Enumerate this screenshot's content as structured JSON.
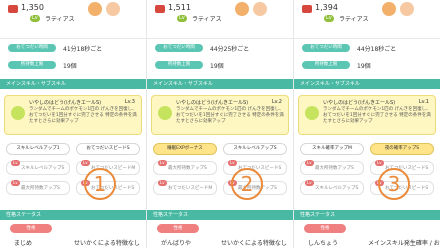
{
  "panels": [
    {
      "hp": "1,350",
      "badge": "Lv",
      "pokemon_name": "ラティアス",
      "stats": [
        {
          "label": "おてつだい時間",
          "value": "41分18秒ごと"
        },
        {
          "label": "所持数上限",
          "value": "19個"
        }
      ],
      "section_title": "メインスキル・サブスキル",
      "skill": {
        "name": "いやしのはどう(げんきエールS)",
        "level": "Lv.3",
        "description": "ランダムでチームのポケモン1匹の げんきを回復し、おてつだいを1回分すぐに完了させる 特定の条件を満たすとさらに効果アップ"
      },
      "buttons": [
        {
          "label": "スキルレベルアップ1",
          "highlight": false
        },
        {
          "label": "おてつだいスピードS",
          "highlight": false
        }
      ],
      "subskills": [
        [
          "スキルレベルアップS",
          "おてつだいスピードM"
        ],
        [
          "最大所持数アップS",
          "おてつだいスピードS"
        ]
      ],
      "number": "1",
      "section2": "性格ステータス",
      "sub_label": "性格",
      "nature": "まじめ",
      "effect": "せいかくによる特徴なし",
      "colors": {
        "pk_a": "#f2b06a",
        "pk_b": "#f7c9a2"
      }
    },
    {
      "hp": "1,511",
      "badge": "Lv",
      "pokemon_name": "ラティアス",
      "stats": [
        {
          "label": "おてつだい時間",
          "value": "44分25秒ごと"
        },
        {
          "label": "所持数上限",
          "value": "19個"
        }
      ],
      "section_title": "メインスキル・サブスキル",
      "skill": {
        "name": "いやしのはどう(げんきエールS)",
        "level": "Lv.2",
        "description": "ランダムでチームのポケモン1匹の げんきを回復し、おてつだいを1回分すぐに完了させる 特定の条件を満たすとさらに効果アップ"
      },
      "buttons": [
        {
          "label": "睡眠EXPボーナス",
          "highlight": true
        },
        {
          "label": "スキルレベルアップS",
          "highlight": false
        }
      ],
      "subskills": [
        [
          "最大所持数アップS",
          "おてつだいスピードS"
        ],
        [
          "おてつだいスピードM",
          "最大所持数アップS"
        ]
      ],
      "number": "2",
      "section2": "性格ステータス",
      "sub_label": "性格",
      "nature": "がんばりや",
      "effect": "せいかくによる特徴なし",
      "colors": {
        "pk_a": "#f2b06a",
        "pk_b": "#f7c9a2"
      }
    },
    {
      "hp": "1,394",
      "badge": "Lv",
      "pokemon_name": "ラティアス",
      "stats": [
        {
          "label": "おてつだい時間",
          "value": "44分18秒ごと"
        },
        {
          "label": "所持数上限",
          "value": "19個"
        }
      ],
      "section_title": "メインスキル・サブスキル",
      "skill": {
        "name": "いやしのはどう(げんきエールS)",
        "level": "Lv.1",
        "description": "ランダムでチームのポケモン1匹の げんきを回復し、おてつだいを1回分すぐに完了させる 特定の条件を満たすとさらに効果アップ"
      },
      "buttons": [
        {
          "label": "スキル確率アップM",
          "highlight": false
        },
        {
          "label": "夜の確率アップS",
          "highlight": true
        }
      ],
      "subskills": [
        [
          "最大所持数アップS",
          "おてつだいスピードS"
        ],
        [
          "スキルレベルアップS",
          "おてつだいスピードS"
        ]
      ],
      "number": "3",
      "section2": "性格ステータス",
      "sub_label": "性格",
      "nature": "しんちょう",
      "effect": "メインスキル発生確率 / おてつだいスピード",
      "colors": {
        "pk_a": "#f2b06a",
        "pk_b": "#f7c9a2"
      }
    }
  ]
}
